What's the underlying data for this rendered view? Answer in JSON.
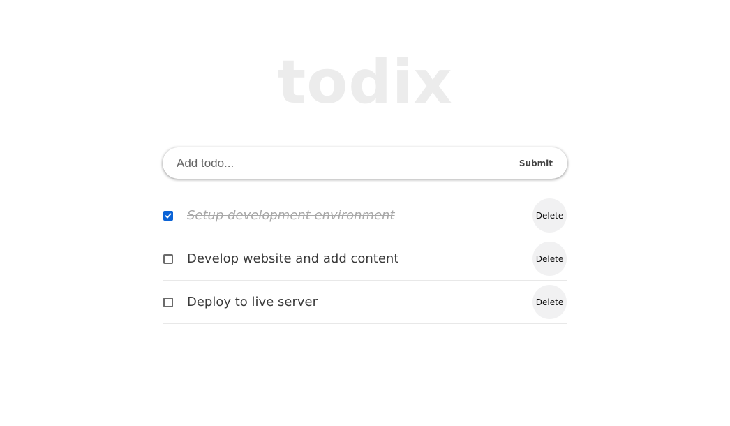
{
  "app": {
    "title": "todix"
  },
  "form": {
    "placeholder": "Add todo...",
    "value": "",
    "submit_label": "Submit"
  },
  "todos": [
    {
      "text": "Setup development environment",
      "completed": true,
      "delete_label": "Delete"
    },
    {
      "text": "Develop website and add content",
      "completed": false,
      "delete_label": "Delete"
    },
    {
      "text": "Deploy to live server",
      "completed": false,
      "delete_label": "Delete"
    }
  ],
  "colors": {
    "checkbox_checked": "#0b63d6",
    "logo": "#ececec"
  },
  "icons": {
    "check": "check-icon"
  }
}
